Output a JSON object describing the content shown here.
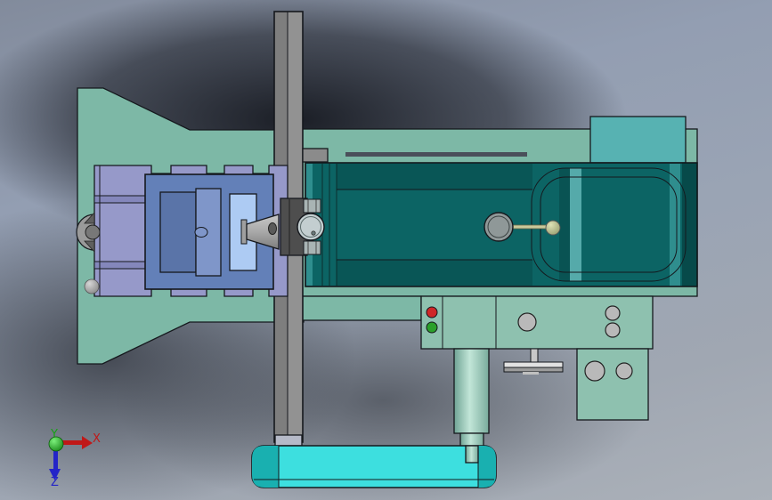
{
  "triad": {
    "x_label": "X",
    "y_label": "Y",
    "z_label": "Z",
    "x_color": "#c01818",
    "y_color": "#16a016",
    "z_color": "#2424c8"
  },
  "colors": {
    "housing_green": "#7db8a6",
    "bracket_green": "#8ec1af",
    "teal_block": "#57b2b2",
    "motor_teal": "#0c6464",
    "table_purple": "#9699c9",
    "table_band_purple": "#8487bb",
    "vise_blue": "#6380b8",
    "vise_jaw_dark": "#5a74a8",
    "vise_jaw_mid": "#7f96c9",
    "vise_jaw_light": "#adcbf3",
    "column_gray": "#8b8b8b",
    "spindle_block_gray": "#4e4e4e",
    "knob_steel": "#c3ced0",
    "base_cyan": "#3ddfdf",
    "base_cyan_dark": "#19b0b0",
    "indicator_red": "#cf2828",
    "indicator_green": "#2aa02a",
    "lever_khaki": "#c9c99b",
    "hole_gray": "#b9b9b9"
  }
}
